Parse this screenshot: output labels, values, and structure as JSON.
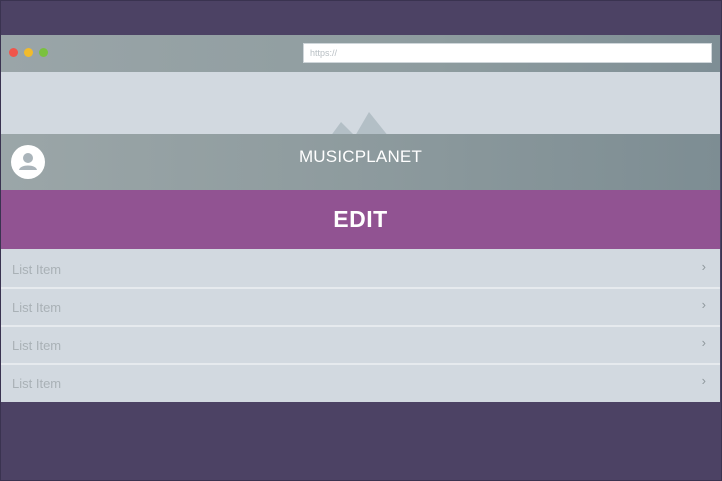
{
  "browser": {
    "url_text": "https://"
  },
  "hero": {
    "brand": "MUSICPLANET"
  },
  "edit_button": {
    "label": "EDIT"
  },
  "list": {
    "items": [
      {
        "label": "List Item",
        "chevron": "›"
      },
      {
        "label": "List Item",
        "chevron": "›"
      },
      {
        "label": "List Item",
        "chevron": "›"
      },
      {
        "label": "List Item",
        "chevron": "›"
      }
    ]
  },
  "icons": {
    "window_controls": [
      "close-dot-icon",
      "minimize-dot-icon",
      "maximize-dot-icon"
    ],
    "hero_image": "mountain-icon",
    "avatar": "user-avatar-icon",
    "list_chevron": "chevron-right-icon"
  },
  "colors": {
    "background": "#4c4264",
    "accent": "#915392",
    "list_bg": "#d2d9e0"
  }
}
